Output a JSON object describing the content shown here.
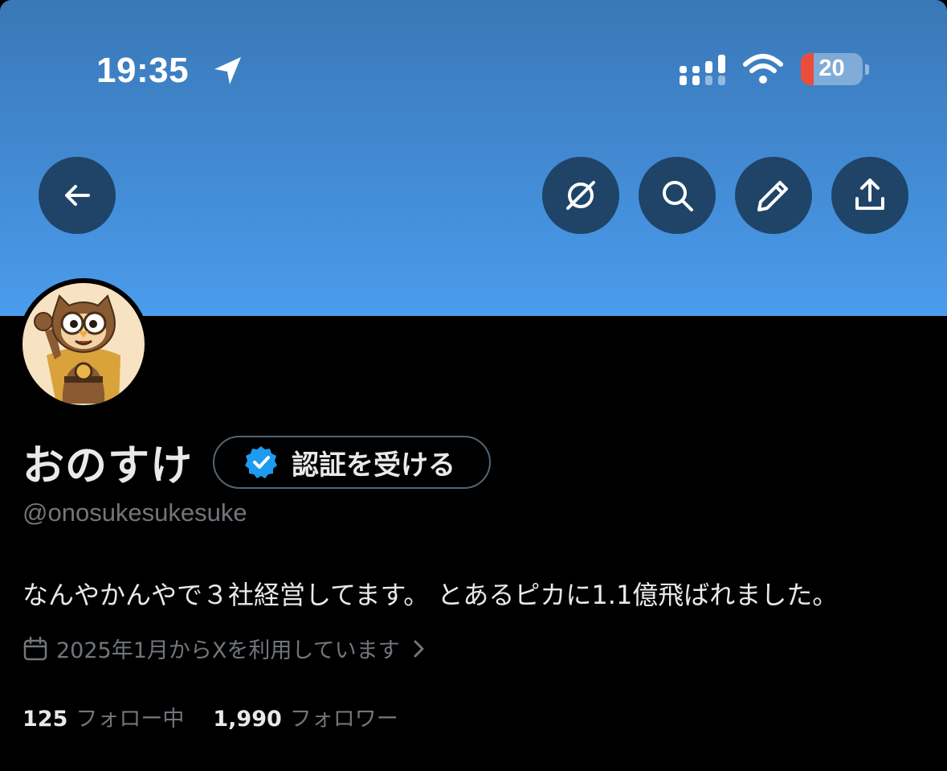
{
  "status_bar": {
    "time": "19:35",
    "battery": "20",
    "icons": [
      "location-arrow-icon",
      "cellular-signal-icon",
      "wifi-icon",
      "battery-icon"
    ]
  },
  "header": {
    "buttons": [
      "back-arrow-icon",
      "grok-icon",
      "search-icon",
      "pencil-icon",
      "share-icon"
    ]
  },
  "profile": {
    "name": "おのすけ",
    "verify_label": "認証を受ける",
    "handle": "@onosukesukesuke",
    "bio": "なんやかんやで３社経営してます。 とあるピカに1.1億飛ばれました。",
    "joined": "2025年1月からXを利用しています",
    "following_count": "125",
    "following_label": "フォロー中",
    "followers_count": "1,990",
    "followers_label": "フォロワー"
  },
  "colors": {
    "banner_top": "#3a78b7",
    "banner_bottom": "#4a9cec",
    "button_bg": "#1f4468",
    "verified_blue": "#1d9bf0",
    "muted_text": "#71767b"
  }
}
